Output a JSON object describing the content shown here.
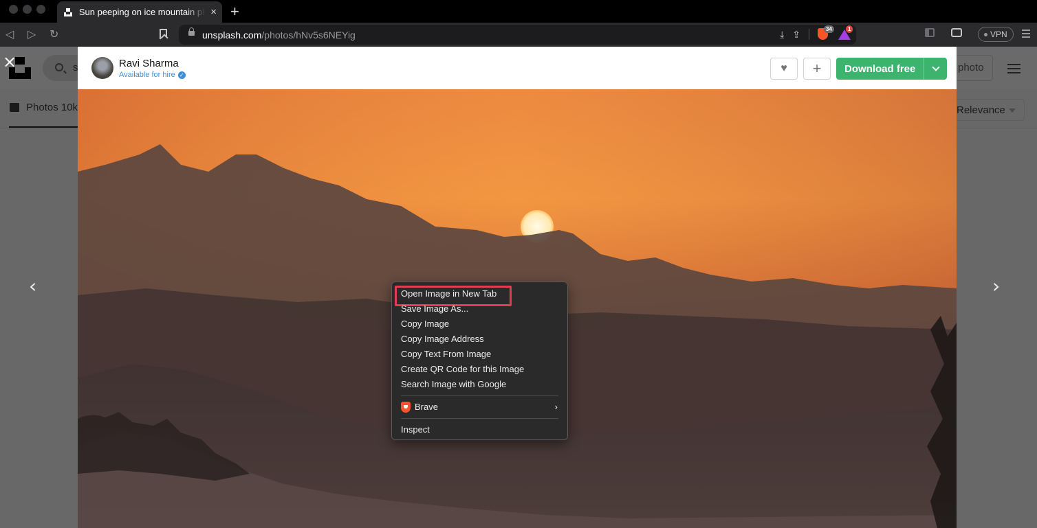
{
  "browser": {
    "tab": {
      "title": "Sun peeping on ice mountain photo – Free Image on Unsplash",
      "close_icon": "×"
    },
    "new_tab_icon": "+",
    "nav": {
      "back_icon": "◁",
      "forward_icon": "▷",
      "reload_icon": "↻"
    },
    "url": {
      "domain": "unsplash.com",
      "path": "/photos/hNv5s6NEYig"
    },
    "actions": {
      "download_icon": "⤓",
      "share_icon": "⇪"
    },
    "shields_count": "34",
    "rewards_count": "1",
    "vpn_label": "VPN"
  },
  "page": {
    "search_query": "s",
    "photos_tab_label": "Photos 10k",
    "submit_label": "photo",
    "sort_label": "Relevance",
    "close_icon": "×",
    "prev_icon": "‹",
    "next_icon": "›"
  },
  "modal": {
    "author": {
      "name": "Ravi Sharma",
      "status": "Available for hire",
      "verified_icon": "✓"
    },
    "like_icon": "♥",
    "add_icon": "+",
    "download_label": "Download free",
    "photo_alt": "Sun peeping on ice mountain"
  },
  "context_menu": {
    "items": [
      {
        "label": "Open Image in New Tab",
        "highlighted": true
      },
      {
        "label": "Save Image As..."
      },
      {
        "label": "Copy Image"
      },
      {
        "label": "Copy Image Address"
      },
      {
        "label": "Copy Text From Image"
      },
      {
        "label": "Create QR Code for this Image"
      },
      {
        "label": "Search Image with Google"
      }
    ],
    "brave": {
      "label": "Brave",
      "arrow": "›"
    },
    "inspect": {
      "label": "Inspect"
    }
  },
  "colors": {
    "download_green": "#3cb46e",
    "highlight_red": "#e43d4f",
    "hire_blue": "#3e8fd6",
    "brave_orange": "#fb542b"
  }
}
